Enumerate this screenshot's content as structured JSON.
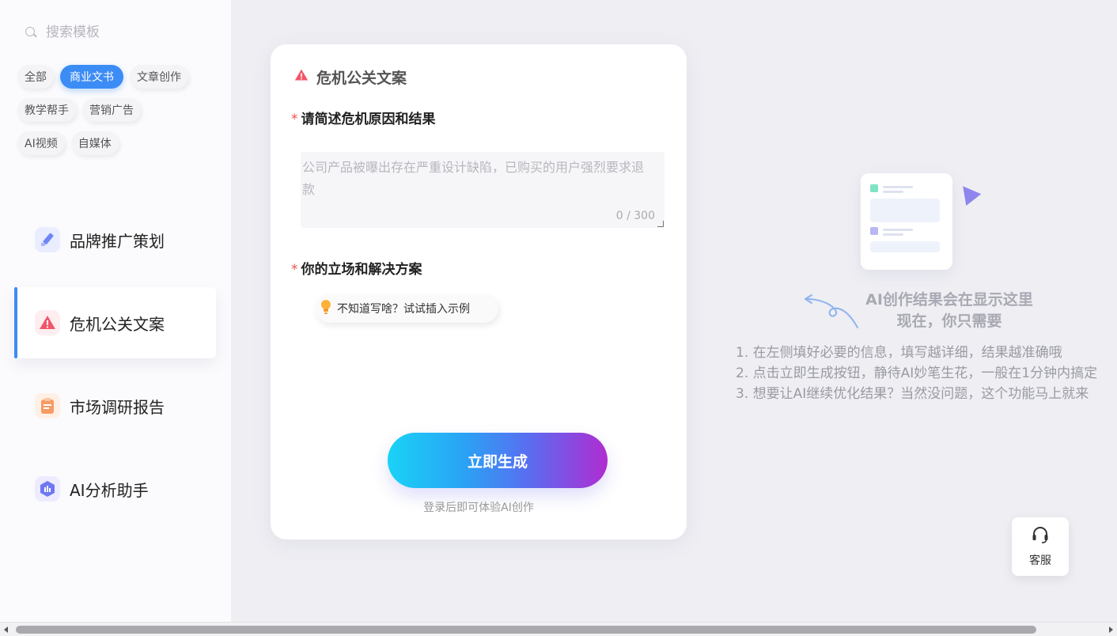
{
  "search": {
    "placeholder": "搜索模板"
  },
  "chips": [
    {
      "label": "全部"
    },
    {
      "label": "商业文书"
    },
    {
      "label": "文章创作"
    },
    {
      "label": "教学帮手"
    },
    {
      "label": "营销广告"
    },
    {
      "label": "AI视频"
    },
    {
      "label": "自媒体"
    }
  ],
  "nav": [
    {
      "label": "品牌推广策划",
      "icon": "brand-pen-icon"
    },
    {
      "label": "危机公关文案",
      "icon": "warning-icon"
    },
    {
      "label": "市场调研报告",
      "icon": "clipboard-icon"
    },
    {
      "label": "AI分析助手",
      "icon": "ai-analysis-icon"
    }
  ],
  "form": {
    "title": "危机公关文案",
    "field1_label": "请简述危机原因和结果",
    "field1_placeholder": "公司产品被曝出存在严重设计缺陷，已购买的用户强烈要求退款",
    "field1_counter": "0 / 300",
    "field2_label": "你的立场和解决方案",
    "hint_button": "不知道写啥？试试插入示例",
    "generate_button": "立即生成",
    "login_note": "登录后即可体验AI创作"
  },
  "placeholder": {
    "title_line1": "AI创作结果会在显示这里",
    "title_line2": "现在，你只需要",
    "steps": [
      "1. 在左侧填好必要的信息，填写越详细，结果越准确哦",
      "2. 点击立即生成按钮，静待AI妙笔生花，一般在1分钟内搞定",
      "3. 想要让AI继续优化结果？当然没问题，这个功能马上就来"
    ]
  },
  "service": {
    "label": "客服"
  },
  "colors": {
    "accent": "#3c8cf5",
    "required": "#f05050"
  }
}
